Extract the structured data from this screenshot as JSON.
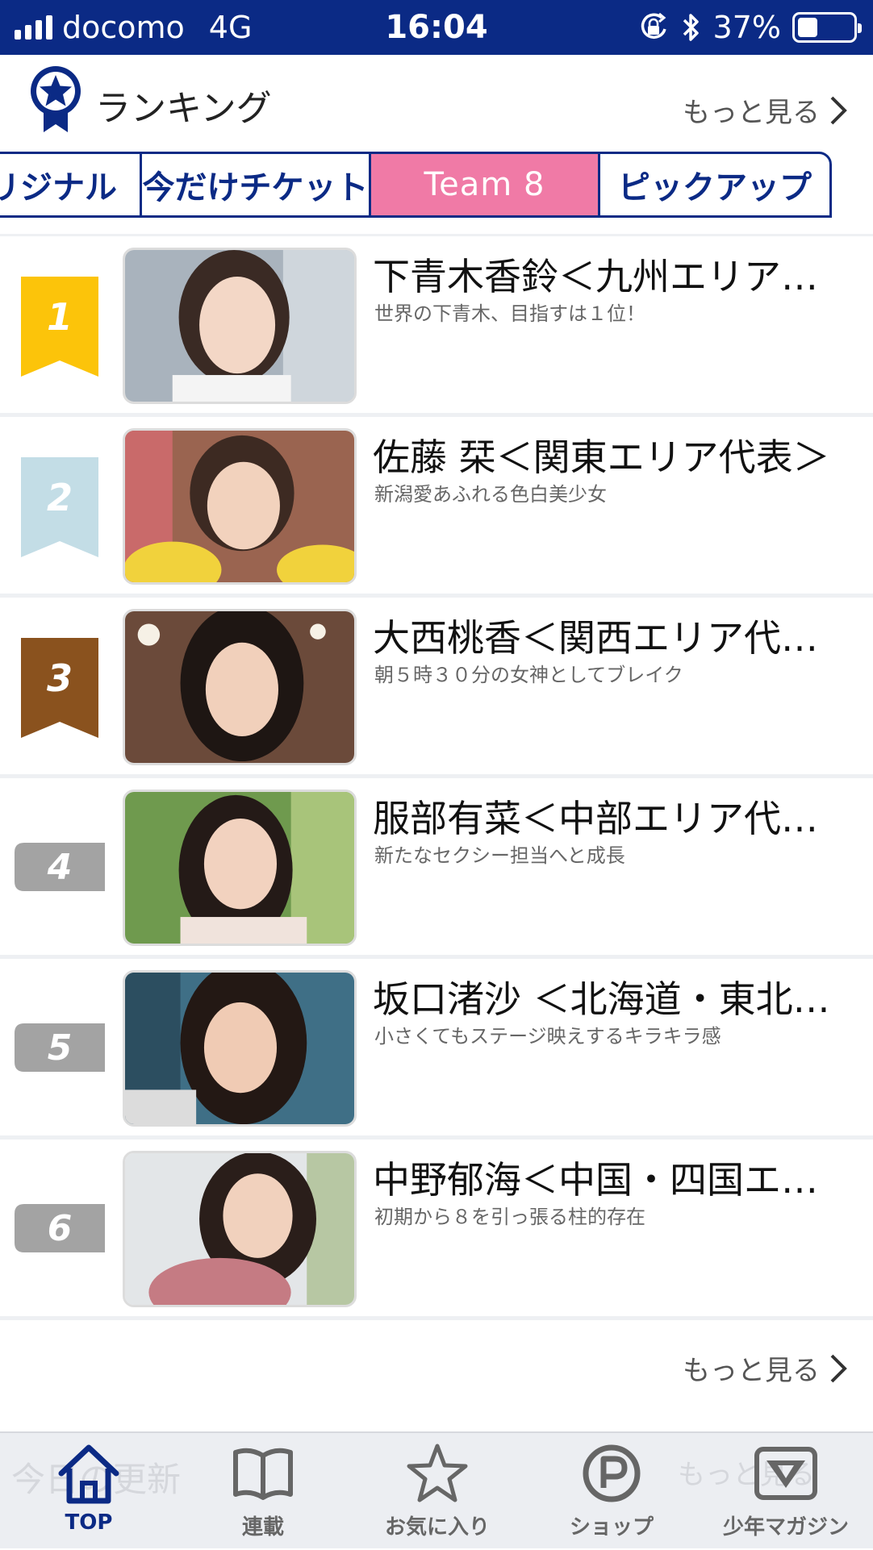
{
  "status_bar": {
    "carrier": "docomo",
    "network": "4G",
    "time": "16:04",
    "battery": "37%",
    "battery_level": 0.37
  },
  "ranking": {
    "title": "ランキング",
    "more": "もっと見る"
  },
  "tabs": [
    {
      "label": "リジナル",
      "active": false
    },
    {
      "label": "今だけチケット",
      "active": false
    },
    {
      "label": "Team 8",
      "active": true
    },
    {
      "label": "ピックアップ",
      "active": false
    }
  ],
  "colors": {
    "brand": "#0b2a85",
    "active_tab": "#f07aa6",
    "gold": "#fcc40a",
    "silver": "#c3dde6",
    "bronze": "#8a521e",
    "gray_badge": "#a3a3a3"
  },
  "items": [
    {
      "rank": "1",
      "title": "下青木香鈴＜九州エリア…",
      "subtitle": "世界の下青木、目指すは１位！"
    },
    {
      "rank": "2",
      "title": "佐藤 栞＜関東エリア代表＞",
      "subtitle": "新潟愛あふれる色白美少女"
    },
    {
      "rank": "3",
      "title": "大西桃香＜関西エリア代…",
      "subtitle": "朝５時３０分の女神としてブレイク"
    },
    {
      "rank": "4",
      "title": "服部有菜＜中部エリア代…",
      "subtitle": "新たなセクシー担当へと成長"
    },
    {
      "rank": "5",
      "title": "坂口渚沙 ＜北海道・東北…",
      "subtitle": "小さくてもステージ映えするキラキラ感"
    },
    {
      "rank": "6",
      "title": "中野郁海＜中国・四国エ…",
      "subtitle": "初期から８を引っ張る柱的存在"
    }
  ],
  "bottom_more": "もっと見る",
  "background_section": {
    "title": "今日の更新",
    "more": "もっと見る"
  },
  "nav": [
    {
      "label": "TOP",
      "icon": "home-icon",
      "active": true
    },
    {
      "label": "連載",
      "icon": "book-icon",
      "active": false
    },
    {
      "label": "お気に入り",
      "icon": "star-icon",
      "active": false
    },
    {
      "label": "ショップ",
      "icon": "shop-p-icon",
      "active": false
    },
    {
      "label": "少年マガジン",
      "icon": "magazine-icon",
      "active": false
    }
  ]
}
